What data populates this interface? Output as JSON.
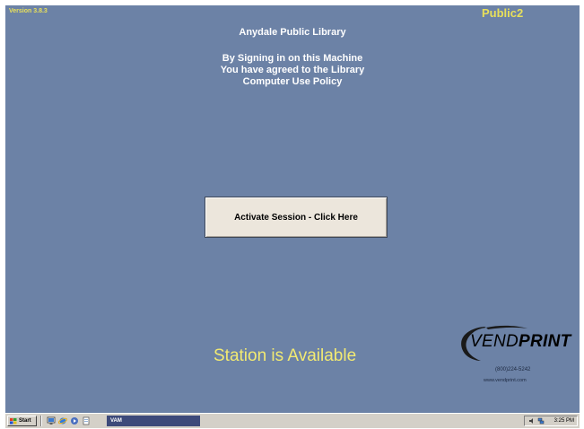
{
  "header": {
    "version": "Version 3.8.3",
    "station_id": "Public2",
    "library_name": "Anydale Public Library",
    "policy_lines": [
      "By Signing in on this Machine",
      "You have agreed to the Library",
      "Computer Use Policy"
    ]
  },
  "main": {
    "activate_button_label": "Activate Session - Click Here",
    "status_text": "Station is Available"
  },
  "branding": {
    "logo_text_thin": "VEND",
    "logo_text_bold": "PRINT",
    "phone": "(800)224-5242",
    "website": "www.vendprint.com"
  },
  "taskbar": {
    "start_label": "Start",
    "quick_launch_icons": [
      "show-desktop-icon",
      "internet-explorer-icon",
      "media-player-icon",
      "notepad-icon"
    ],
    "task_label": "VAM",
    "tray_icons": [
      "speaker-icon",
      "network-icon"
    ],
    "clock": "3:25 PM"
  },
  "colors": {
    "background": "#6c82a6",
    "accent_yellow": "#e8e05a",
    "status_yellow": "#f2ea72",
    "button_face": "#ece6dc",
    "taskbar": "#d4d0c8"
  }
}
